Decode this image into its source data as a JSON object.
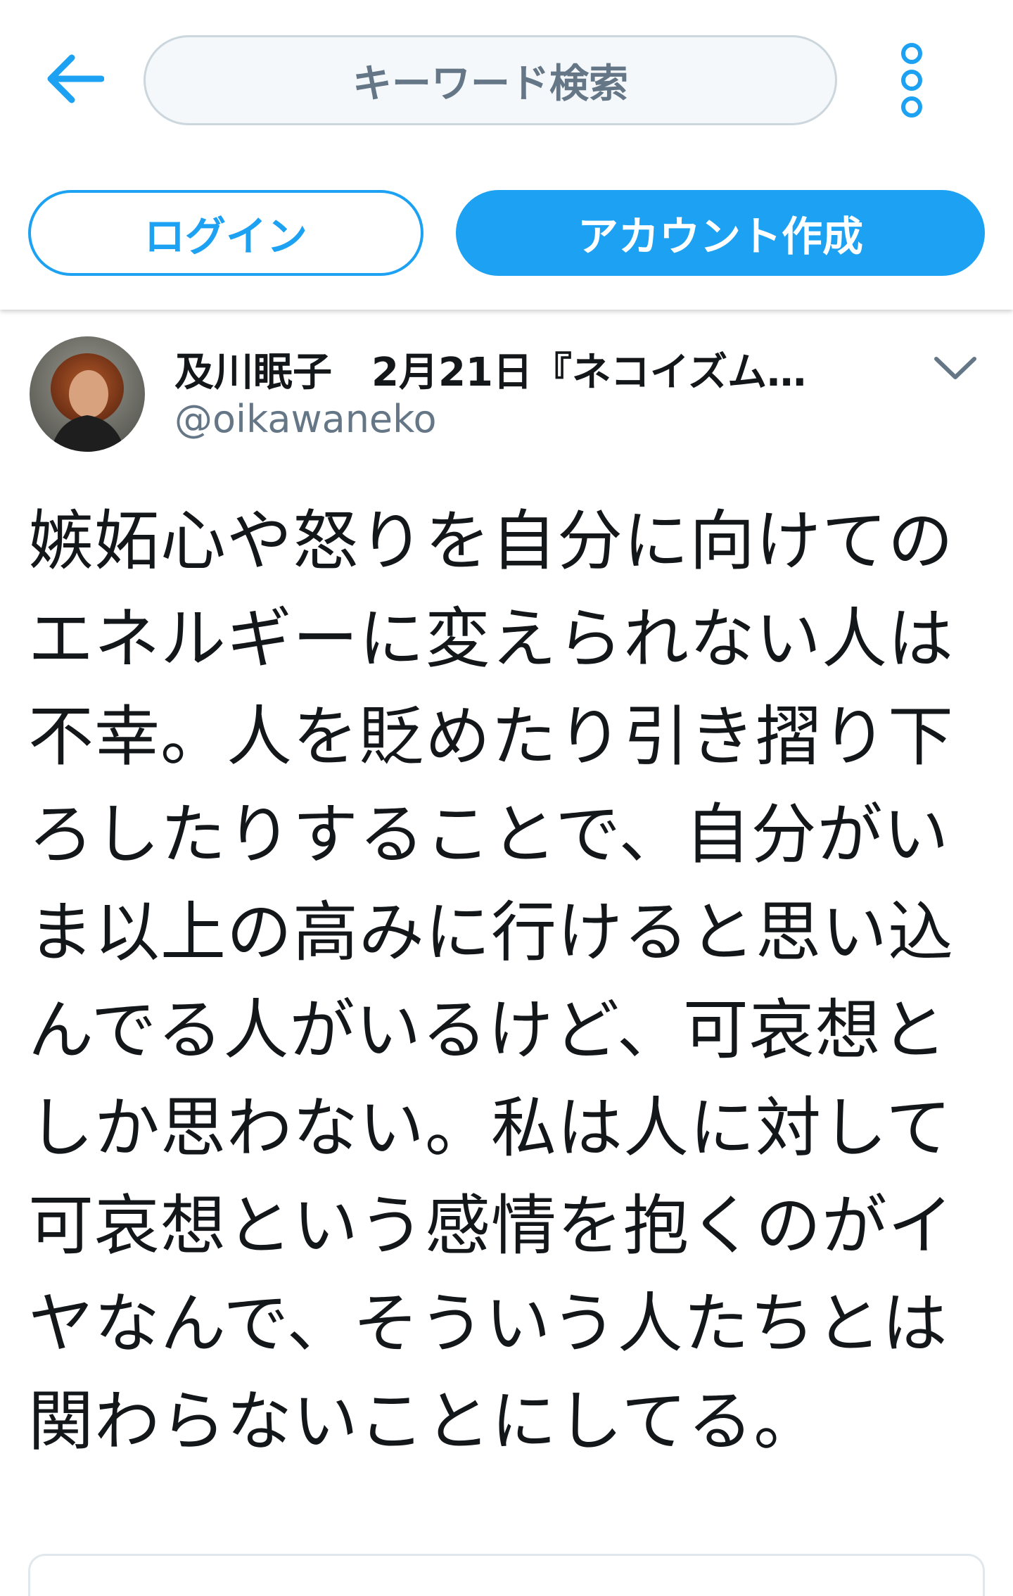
{
  "colors": {
    "accent": "#1da1f2",
    "text": "#14171a",
    "secondary_text": "#657786",
    "search_bg": "#f5f8fa",
    "border": "#ccd6dd"
  },
  "header": {
    "back_icon": "arrow-left-icon",
    "search": {
      "placeholder": "キーワード検索"
    },
    "more_icon": "vertical-ellipsis-icon",
    "login_label": "ログイン",
    "signup_label": "アカウント作成"
  },
  "tweet": {
    "author": {
      "display_name": "及川眠子　2月21日『ネコイズム…",
      "handle": "@oikawaneko",
      "avatar_icon": "user-avatar"
    },
    "menu_icon": "chevron-down-icon",
    "text": "嫉妬心や怒りを自分に向けてのエネルギーに変えられない人は不幸。人を貶めたり引き摺り下ろしたりすることで、自分がいま以上の高みに行けると思い込んでる人がいるけど、可哀想としか思わない。私は人に対して可哀想という感情を抱くのがイヤなんで、そういう人たちとは関わらないことにしてる。"
  }
}
